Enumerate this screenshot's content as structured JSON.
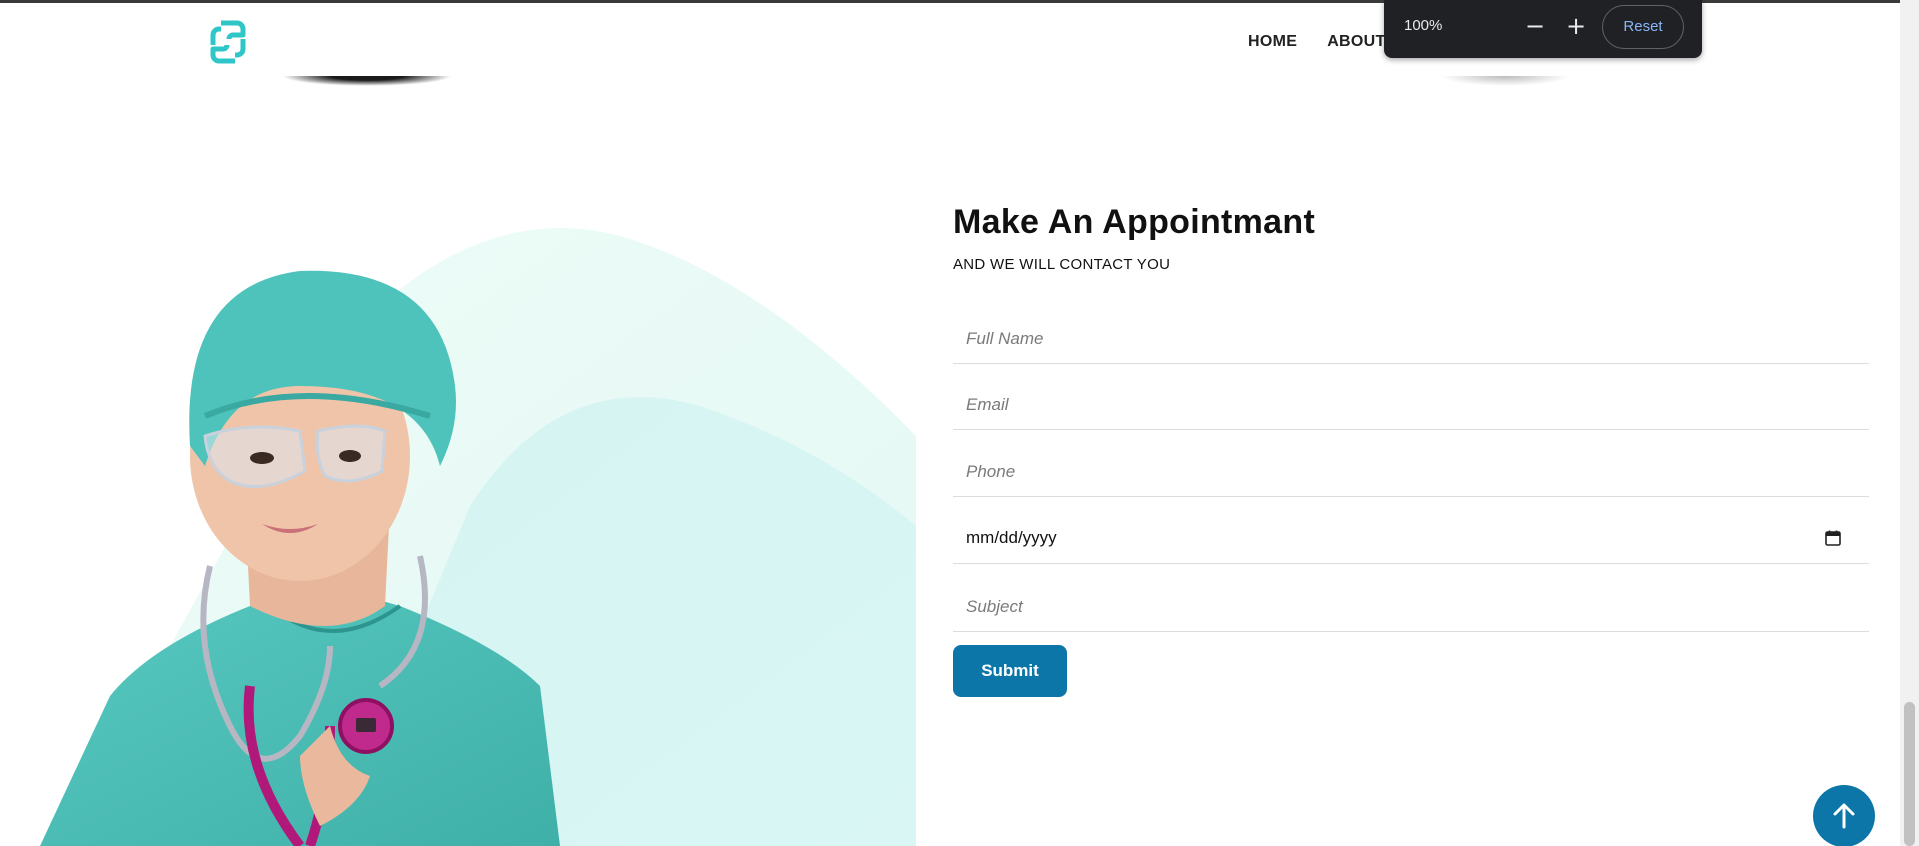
{
  "header": {
    "nav": [
      {
        "label": "HOME"
      },
      {
        "label": "ABOUT"
      }
    ]
  },
  "zoom_popup": {
    "value": "100%",
    "minus": "−",
    "plus": "+",
    "reset_label": "Reset"
  },
  "appointment": {
    "title": "Make An Appointmant",
    "subtitle": "AND WE WILL CONTACT YOU",
    "fields": {
      "full_name_placeholder": "Full Name",
      "email_placeholder": "Email",
      "phone_placeholder": "Phone",
      "date_value": "mm/dd/yyyy",
      "subject_placeholder": "Subject"
    },
    "submit_label": "Submit"
  },
  "colors": {
    "accent": "#0c76a8",
    "logo": "#2fc6c8",
    "scrub": "#4fbfb8",
    "stethoscope": "#b0197a"
  }
}
